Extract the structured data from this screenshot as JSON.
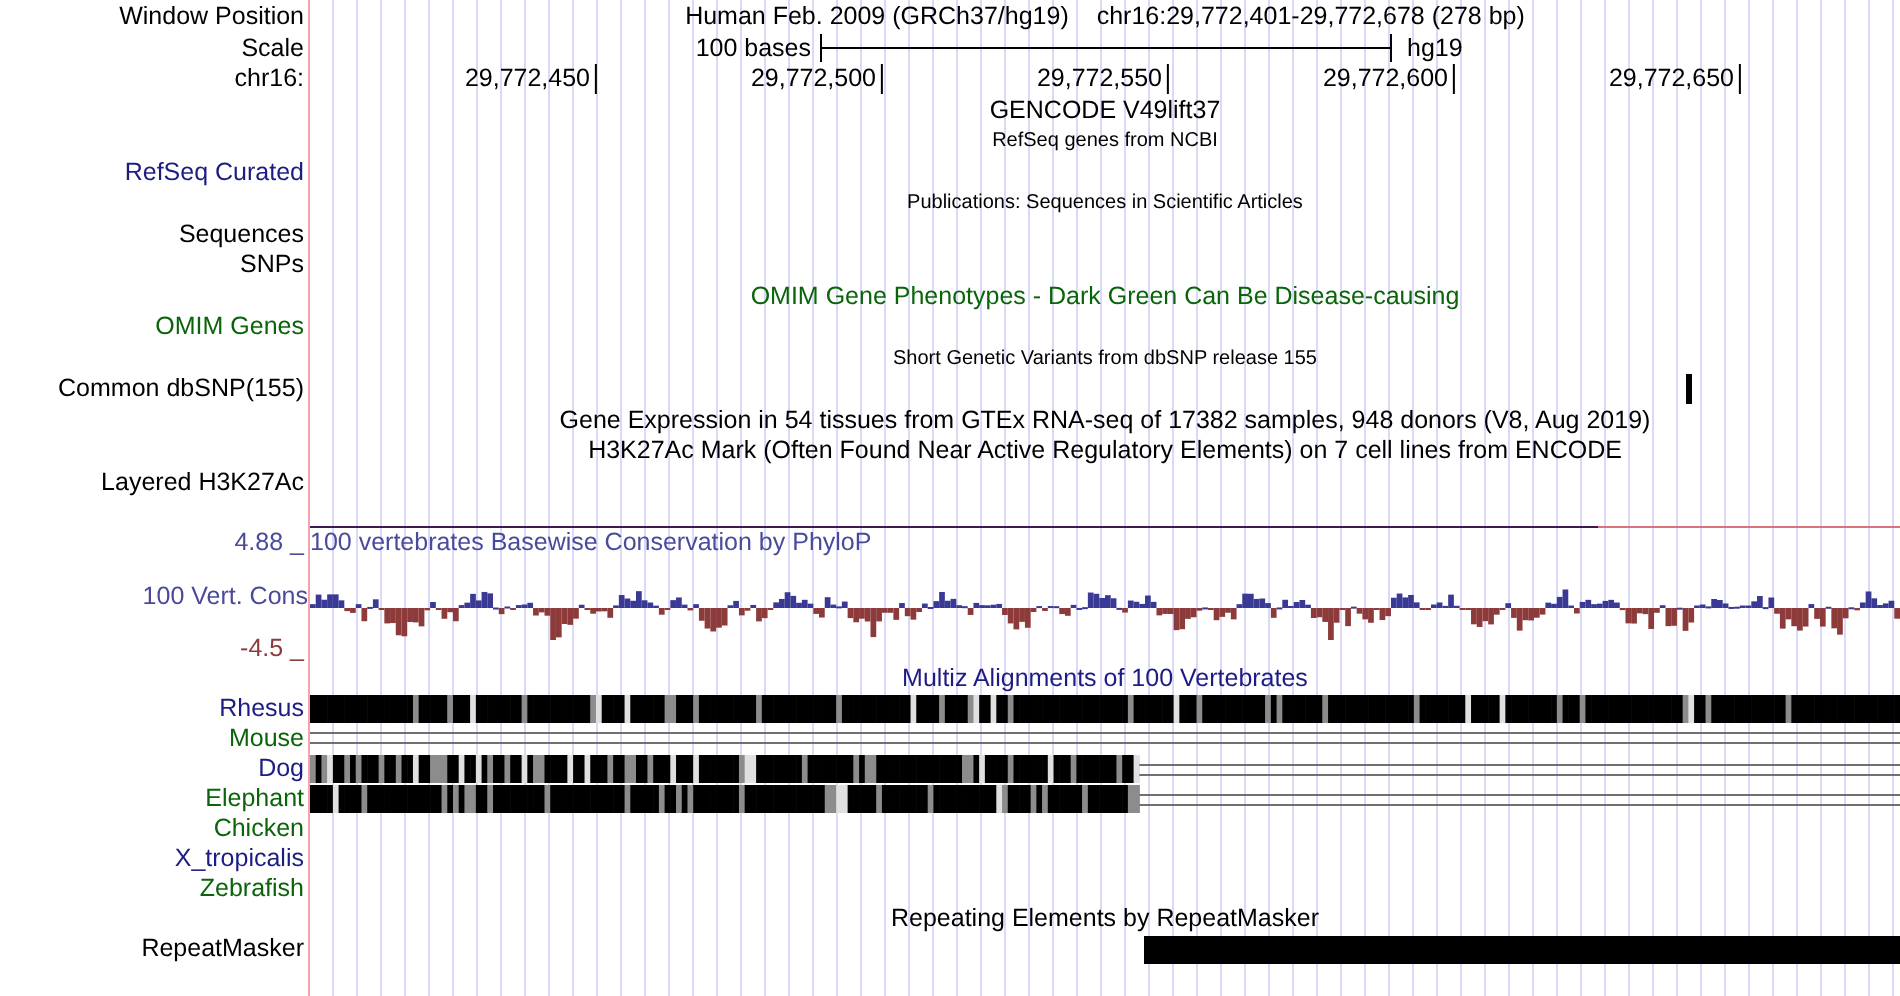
{
  "header": {
    "window_position": {
      "label": "Window Position",
      "assembly": "Human Feb. 2009 (GRCh37/hg19)",
      "position": "chr16:29,772,401-29,772,678 (278 bp)"
    },
    "scale": {
      "label": "Scale",
      "length": "100 bases",
      "assembly": "hg19"
    },
    "ruler": {
      "label": "chr16:",
      "ticks": [
        "29,772,450",
        "29,772,500",
        "29,772,550",
        "29,772,600",
        "29,772,650"
      ]
    }
  },
  "tracks": [
    {
      "kind": "title",
      "text": "GENCODE V49lift37",
      "color": "#000000"
    },
    {
      "kind": "subtitle",
      "text": "RefSeq genes from NCBI"
    },
    {
      "kind": "label",
      "label": "RefSeq Curated",
      "color": "#1c1c84"
    },
    {
      "kind": "subtitle",
      "text": "Publications: Sequences in Scientific Articles"
    },
    {
      "kind": "label",
      "label": "Sequences",
      "color": "#000000"
    },
    {
      "kind": "label",
      "label": "SNPs",
      "color": "#000000"
    },
    {
      "kind": "title",
      "text": "OMIM Gene Phenotypes - Dark Green Can Be Disease-causing",
      "color": "#0a640a"
    },
    {
      "kind": "label",
      "label": "OMIM Genes",
      "color": "#0a640a"
    },
    {
      "kind": "subtitle",
      "text": "Short Genetic Variants from dbSNP release 155"
    },
    {
      "kind": "variant",
      "label": "Common dbSNP(155)"
    },
    {
      "kind": "title",
      "text": "Gene Expression in 54 tissues from GTEx RNA-seq of 17382 samples, 948 donors (V8, Aug 2019)",
      "color": "#000000"
    },
    {
      "kind": "title",
      "text": "H3K27Ac Mark (Often Found Near Active Regulatory Elements) on 7 cell lines from ENCODE",
      "color": "#000000"
    },
    {
      "kind": "label",
      "label": "Layered H3K27Ac",
      "color": "#000000"
    },
    {
      "kind": "conservation",
      "title": "100 vertebrates Basewise Conservation by PhyloP",
      "label": "100 Vert. Cons",
      "max": "4.88 _",
      "min": "-4.5 _"
    },
    {
      "kind": "title",
      "text": "Multiz Alignments of 100 Vertebrates",
      "color": "#1c1c84"
    },
    {
      "kind": "aligned",
      "label": "Rhesus",
      "color": "#1c1c84"
    },
    {
      "kind": "unaligned",
      "label": "Mouse",
      "color": "#0a640a"
    },
    {
      "kind": "partial",
      "label": "Dog",
      "color": "#1c1c84"
    },
    {
      "kind": "partial",
      "label": "Elephant",
      "color": "#0a640a"
    },
    {
      "kind": "label",
      "label": "Chicken",
      "color": "#0a640a"
    },
    {
      "kind": "label",
      "label": "X_tropicalis",
      "color": "#1c1c84"
    },
    {
      "kind": "label",
      "label": "Zebrafish",
      "color": "#0a640a"
    },
    {
      "kind": "title",
      "text": "Repeating Elements by RepeatMasker",
      "color": "#000000"
    },
    {
      "kind": "repeat",
      "label": "RepeatMasker"
    }
  ]
}
